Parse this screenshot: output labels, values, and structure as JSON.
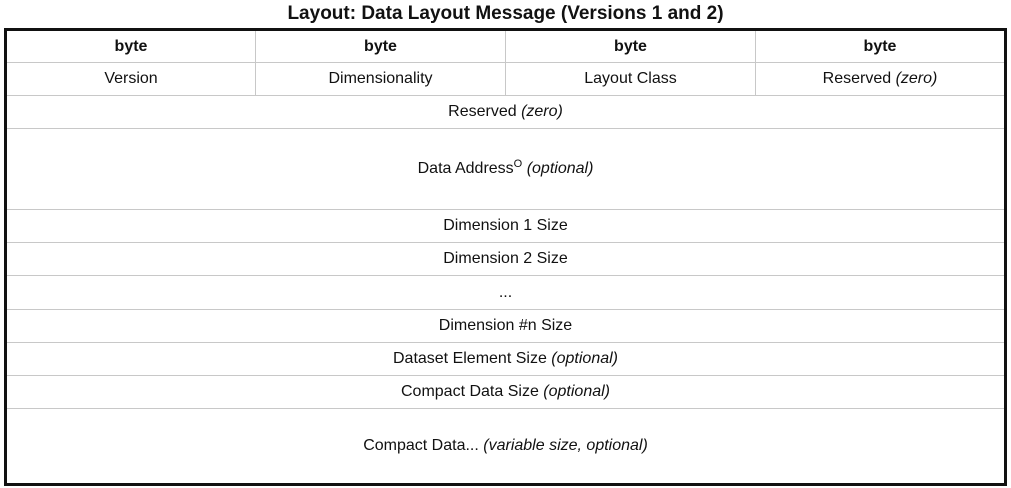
{
  "caption": "Layout: Data Layout Message (Versions 1 and 2)",
  "header": [
    "byte",
    "byte",
    "byte",
    "byte"
  ],
  "row1": {
    "version": "Version",
    "dimensionality": "Dimensionality",
    "layout_class": "Layout Class",
    "reserved": "Reserved",
    "reserved_note": "(zero)"
  },
  "rows": {
    "reserved": {
      "label": "Reserved",
      "note": "(zero)"
    },
    "data_address": {
      "label": "Data Address",
      "marker": "O",
      "note": "(optional)"
    },
    "dim1": {
      "label": "Dimension 1 Size"
    },
    "dim2": {
      "label": "Dimension 2 Size"
    },
    "ellipsis": {
      "label": "..."
    },
    "dimn": {
      "label": "Dimension #n Size"
    },
    "element_size": {
      "label": "Dataset Element Size",
      "note": "(optional)"
    },
    "compact_size": {
      "label": "Compact Data Size",
      "note": "(optional)"
    },
    "compact_data": {
      "label": "Compact Data...",
      "note": "(variable size, optional)"
    }
  }
}
